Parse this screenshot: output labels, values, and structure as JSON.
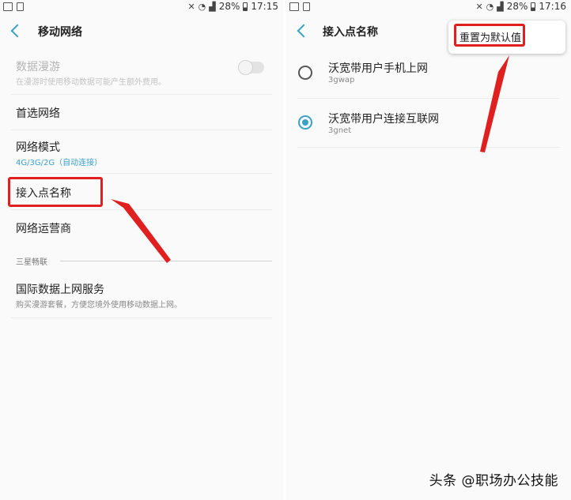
{
  "left_screen": {
    "status": {
      "battery": "28%",
      "time": "17:15"
    },
    "appbar": {
      "title": "移动网络"
    },
    "items": [
      {
        "title": "数据漫游",
        "subtitle": "在漫游时使用移动数据可能产生额外费用。"
      },
      {
        "title": "首选网络"
      },
      {
        "title": "网络模式",
        "subtitle": "4G/3G/2G（自动连接）"
      },
      {
        "title": "接入点名称"
      },
      {
        "title": "网络运营商"
      }
    ],
    "section": {
      "header": "三星畅联"
    },
    "global_data": {
      "title": "国际数据上网服务",
      "subtitle": "购买漫游套餐，方便您境外使用移动数据上网。"
    }
  },
  "right_screen": {
    "status": {
      "battery": "28%",
      "time": "17:16"
    },
    "appbar": {
      "title": "接入点名称"
    },
    "apns": [
      {
        "title": "沃宽带用户手机上网",
        "subtitle": "3gwap",
        "selected": false
      },
      {
        "title": "沃宽带用户连接互联网",
        "subtitle": "3gnet",
        "selected": true
      }
    ],
    "menu": {
      "reset_label": "重置为默认值"
    }
  },
  "watermark": "头条 @职场办公技能",
  "colors": {
    "accent": "#3aa1c9",
    "annotation_red": "#e02020",
    "subtitle_blue": "#3aa1c9"
  }
}
